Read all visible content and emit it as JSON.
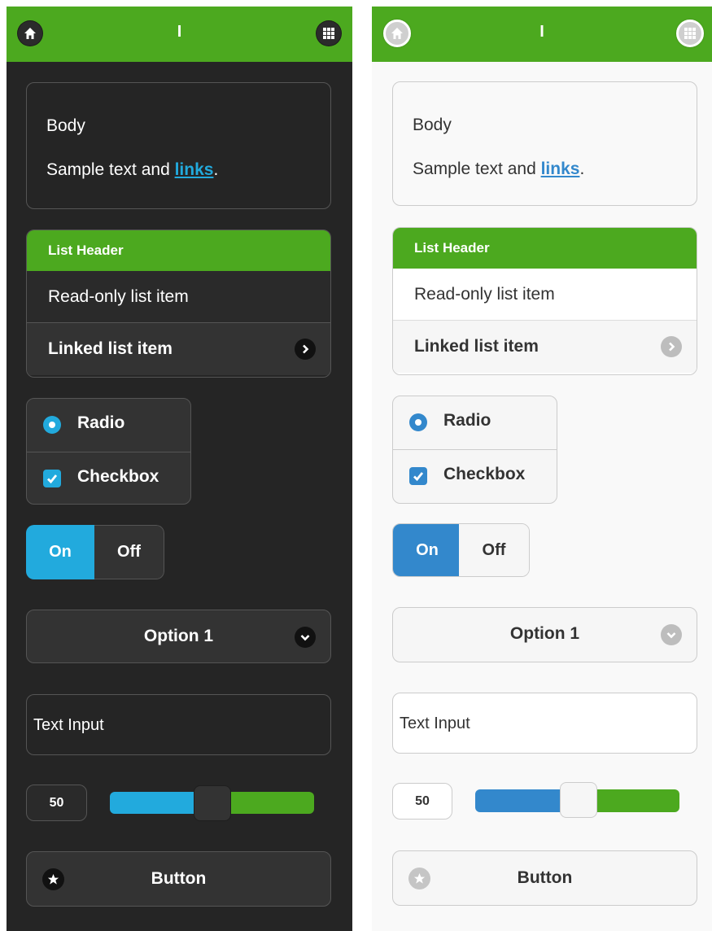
{
  "themes": [
    {
      "header": {
        "title": "I"
      },
      "body": {
        "heading": "Body",
        "text_before_link": "Sample text and ",
        "link": "links",
        "text_after_link": "."
      },
      "list": {
        "header": "List Header",
        "readonly_item": "Read-only list item",
        "linked_item": "Linked list item"
      },
      "radio": {
        "label": "Radio",
        "checked": true
      },
      "checkbox": {
        "label": "Checkbox",
        "checked": true
      },
      "flipswitch": {
        "on_label": "On",
        "off_label": "Off",
        "state": "On"
      },
      "select": {
        "selected_option": "Option 1"
      },
      "text_input": {
        "value": "Text Input"
      },
      "slider": {
        "value": "50",
        "fraction": 0.5
      },
      "button": {
        "label": "Button"
      },
      "icons": {
        "home": "home-icon",
        "grid": "grid-icon",
        "chevron_right": "chevron-right-icon",
        "chevron_down": "chevron-down-icon",
        "star": "star-icon"
      },
      "colors": {
        "header": "#4ca91f",
        "accent": "#22aadd",
        "background": "#252525"
      }
    },
    {
      "header": {
        "title": "I"
      },
      "body": {
        "heading": "Body",
        "text_before_link": "Sample text and ",
        "link": "links",
        "text_after_link": "."
      },
      "list": {
        "header": "List Header",
        "readonly_item": "Read-only list item",
        "linked_item": "Linked list item"
      },
      "radio": {
        "label": "Radio",
        "checked": true
      },
      "checkbox": {
        "label": "Checkbox",
        "checked": true
      },
      "flipswitch": {
        "on_label": "On",
        "off_label": "Off",
        "state": "On"
      },
      "select": {
        "selected_option": "Option 1"
      },
      "text_input": {
        "value": "Text Input"
      },
      "slider": {
        "value": "50",
        "fraction": 0.5
      },
      "button": {
        "label": "Button"
      },
      "icons": {
        "home": "home-icon",
        "grid": "grid-icon",
        "chevron_right": "chevron-right-icon",
        "chevron_down": "chevron-down-icon",
        "star": "star-icon"
      },
      "colors": {
        "header": "#4ca91f",
        "accent": "#3388cc",
        "background": "#f9f9f9"
      }
    }
  ]
}
